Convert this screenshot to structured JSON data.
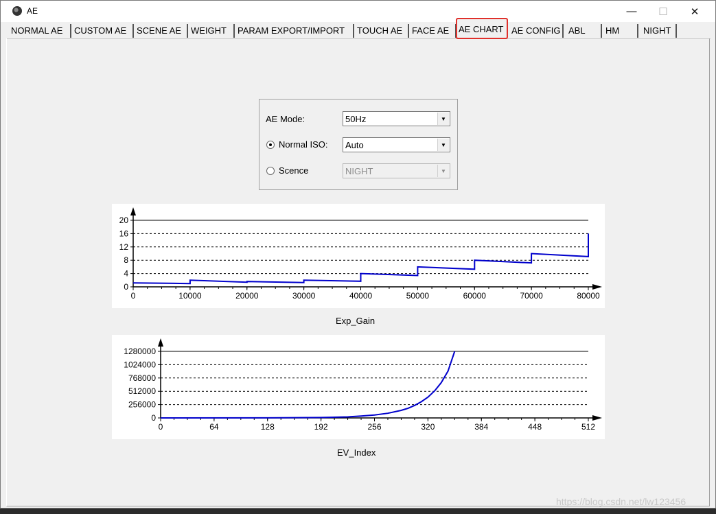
{
  "window": {
    "title": "AE"
  },
  "titlebar_buttons": {
    "minimize": "—",
    "maximize": "☐",
    "close": "✕"
  },
  "tabs": [
    {
      "label": "NORMAL AE"
    },
    {
      "label": "CUSTOM AE"
    },
    {
      "label": "SCENE AE"
    },
    {
      "label": "WEIGHT"
    },
    {
      "label": "PARAM EXPORT/IMPORT"
    },
    {
      "label": "TOUCH AE"
    },
    {
      "label": "FACE AE"
    },
    {
      "label": "AE CHART"
    },
    {
      "label": "AE CONFIG"
    },
    {
      "label": "ABL"
    },
    {
      "label": "HM"
    },
    {
      "label": "NIGHT"
    }
  ],
  "active_tab": "AE CHART",
  "highlight_color": "#e0302b",
  "form": {
    "ae_mode_label": "AE Mode:",
    "ae_mode_value": "50Hz",
    "normal_iso_label": "Normal ISO:",
    "normal_iso_value": "Auto",
    "normal_iso_selected": true,
    "scene_label": "Scence",
    "scene_value": "NIGHT",
    "scene_enabled": false
  },
  "chart_data": [
    {
      "type": "line",
      "title": "",
      "xlabel": "Exp_Gain",
      "ylabel": "",
      "xlim": [
        0,
        80000
      ],
      "ylim": [
        0,
        20
      ],
      "x_ticks": [
        0,
        10000,
        20000,
        30000,
        40000,
        50000,
        60000,
        70000,
        80000
      ],
      "y_ticks": [
        0,
        4,
        8,
        12,
        16,
        20
      ],
      "grid": "horizontal-dashed",
      "line_color": "#0000cc",
      "series": [
        {
          "x": [
            0,
            10000,
            10000,
            20000,
            20000,
            30000,
            30000,
            40000,
            40000,
            50000,
            50000,
            60000,
            60000,
            70000,
            70000,
            80000,
            80000
          ],
          "y": [
            1.2,
            1.0,
            2.0,
            1.4,
            1.6,
            1.3,
            2.0,
            1.7,
            4.0,
            3.4,
            6.0,
            5.3,
            8.0,
            7.2,
            10.0,
            9.1,
            16.0
          ]
        }
      ]
    },
    {
      "type": "line",
      "title": "",
      "xlabel": "EV_Index",
      "ylabel": "",
      "xlim": [
        0,
        512
      ],
      "ylim": [
        0,
        1280000
      ],
      "x_ticks": [
        0,
        64,
        128,
        192,
        256,
        320,
        384,
        448,
        512
      ],
      "y_ticks": [
        0,
        256000,
        512000,
        768000,
        1024000,
        1280000
      ],
      "grid": "horizontal-dashed",
      "line_color": "#0000cc",
      "series": [
        {
          "x": [
            0,
            128,
            192,
            224,
            240,
            256,
            272,
            288,
            296,
            304,
            312,
            320,
            328,
            336,
            344,
            352
          ],
          "y": [
            0,
            1500,
            8000,
            20000,
            35000,
            55000,
            90000,
            145000,
            185000,
            240000,
            310000,
            400000,
            520000,
            680000,
            900000,
            1280000
          ]
        }
      ]
    }
  ],
  "watermark": "https://blog.csdn.net/lw123456"
}
